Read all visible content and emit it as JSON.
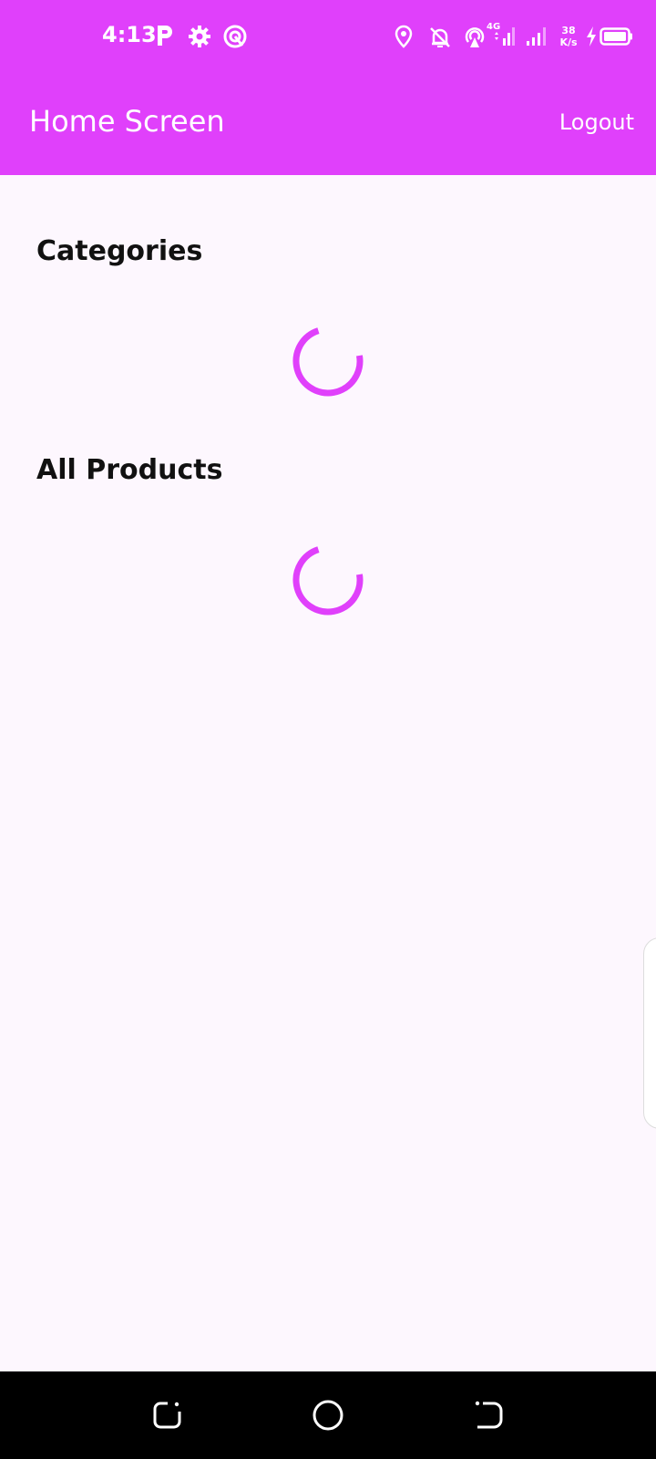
{
  "status_bar": {
    "time": "4:13",
    "network_type": "4G",
    "speed_value": "38",
    "speed_unit": "K/s",
    "icons": [
      "parking-icon",
      "settings-icon",
      "hotspot-app-icon",
      "location-icon",
      "notifications-off-icon",
      "hotspot-icon",
      "signal-4g-icon",
      "signal-icon",
      "charging-icon",
      "battery-icon"
    ]
  },
  "appbar": {
    "title": "Home Screen",
    "logout_label": "Logout"
  },
  "sections": {
    "categories_title": "Categories",
    "products_title": "All Products"
  },
  "colors": {
    "accent": "#e040fb",
    "background": "#fdf7fe",
    "text": "#111111",
    "nav_bar": "#000000"
  },
  "nav_bar": {
    "icons": [
      "recent-apps-icon",
      "home-icon",
      "back-icon"
    ]
  }
}
